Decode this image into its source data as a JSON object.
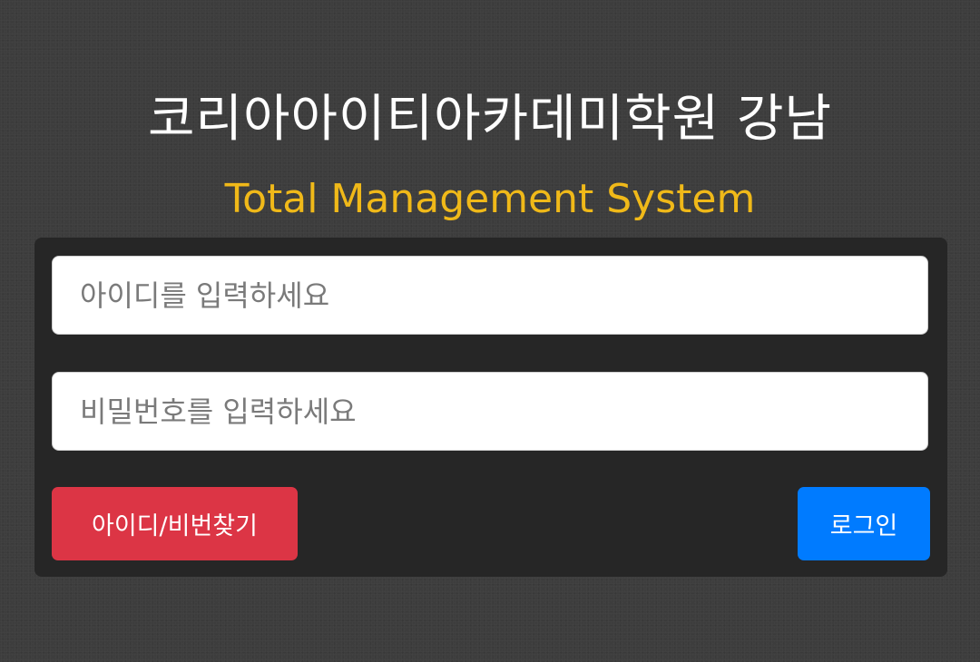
{
  "header": {
    "title": "코리아아이티아카데미학원 강남",
    "subtitle": "Total Management System"
  },
  "login_form": {
    "id_placeholder": "아이디를 입력하세요",
    "password_placeholder": "비밀번호를 입력하세요",
    "find_account_label": "아이디/비번찾기",
    "login_label": "로그인"
  },
  "colors": {
    "subtitle": "#f0b919",
    "find_button": "#dc3545",
    "login_button": "#007bff",
    "panel": "#262626",
    "background": "#3d3d3d"
  }
}
